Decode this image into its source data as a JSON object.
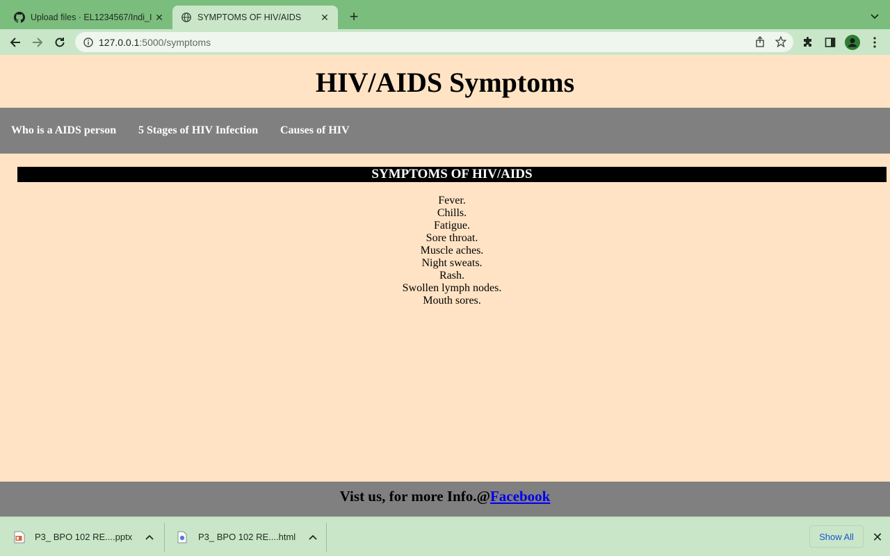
{
  "browser": {
    "tabs": [
      {
        "title": "Upload files · EL1234567/Indi_I",
        "icon": "github-icon",
        "active": false
      },
      {
        "title": "SYMPTOMS OF HIV/AIDS",
        "icon": "globe-icon",
        "active": true
      }
    ],
    "url": {
      "host": "127.0.0.1",
      "path": ":5000/symptoms"
    }
  },
  "page": {
    "title": "HIV/AIDS Symptoms",
    "nav": [
      {
        "label": "Who is a AIDS person"
      },
      {
        "label": "5 Stages of HIV Infection"
      },
      {
        "label": "Causes of HIV"
      }
    ],
    "section_heading": "SYMPTOMS OF HIV/AIDS",
    "symptoms": [
      "Fever.",
      "Chills.",
      "Fatigue.",
      "Sore throat.",
      "Muscle aches.",
      "Night sweats.",
      "Rash.",
      "Swollen lymph nodes.",
      "Mouth sores."
    ],
    "footer": {
      "text": "Vist us, for more Info.@",
      "link_label": "Facebook"
    }
  },
  "downloads": {
    "items": [
      {
        "name": "P3_ BPO 102 RE....pptx",
        "icon": "pptx-file-icon"
      },
      {
        "name": "P3_ BPO 102 RE....html",
        "icon": "html-file-icon"
      }
    ],
    "show_all_label": "Show All"
  },
  "colors": {
    "tabstrip": "#7bbd7d",
    "toolbar": "#c9e6c9",
    "page_background": "#ffe3c4",
    "navbar": "#808080",
    "heading_bar": "#000000",
    "link": "#0000ee"
  }
}
